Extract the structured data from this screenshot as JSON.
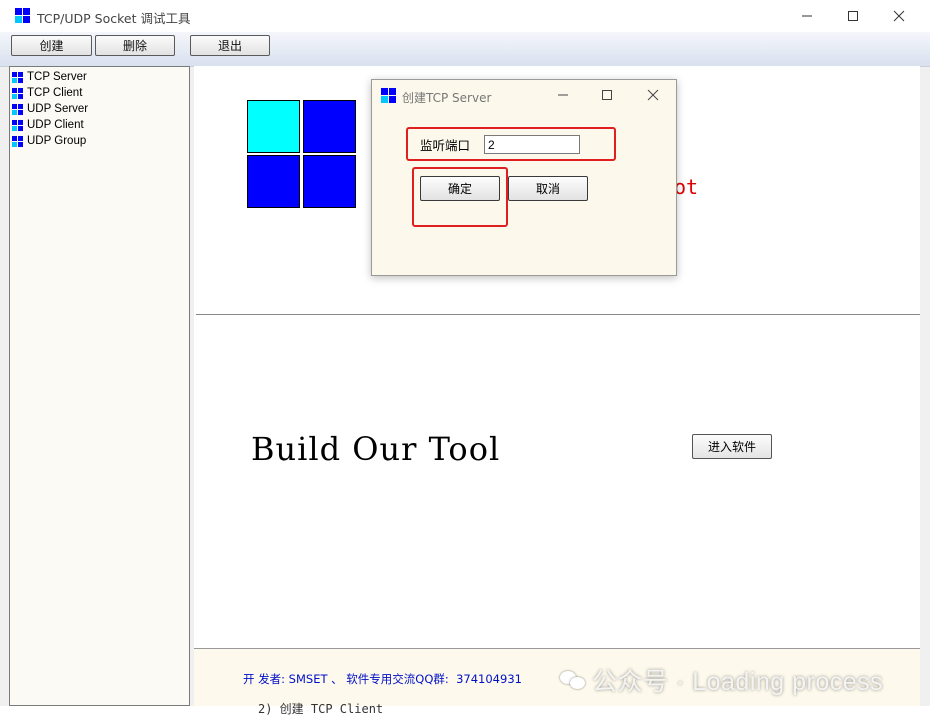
{
  "window": {
    "title": "TCP/UDP Socket 调试工具"
  },
  "toolbar": {
    "create_label": "创建",
    "delete_label": "删除",
    "exit_label": "退出"
  },
  "tree": {
    "items": [
      {
        "label": "TCP Server"
      },
      {
        "label": "TCP Client"
      },
      {
        "label": "UDP Server"
      },
      {
        "label": "UDP Client"
      },
      {
        "label": "UDP Group"
      }
    ]
  },
  "content": {
    "partial_red_text": "ot",
    "build_text": "Build Our Tool",
    "enter_button": "进入软件",
    "footer_text": "开 发者: SMSET 、 软件专用交流QQ群:  374104931"
  },
  "watermark": {
    "text": "公众号 · Loading process"
  },
  "bottom_peek_text": "2) 创建 TCP Client",
  "dialog": {
    "title": "创建TCP Server",
    "port_label": "监听端口",
    "port_value": "2",
    "ok_label": "确定",
    "cancel_label": "取消"
  },
  "colors": {
    "logo_cyan": "#00ffff",
    "logo_blue": "#0000ff",
    "highlight_red": "#e02020",
    "footer_text_blue": "#0010c8"
  }
}
